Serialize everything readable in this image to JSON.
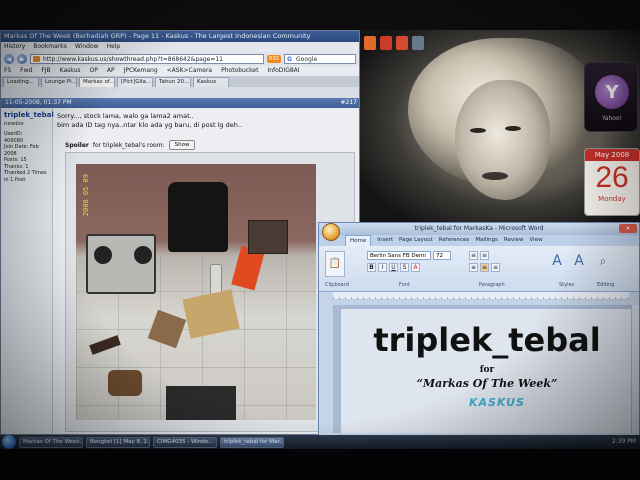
{
  "browser": {
    "title": "Markas Of The Week (Berhadiah GRP) - Page 11 - Kaskus - The Largest Indonesian Community",
    "menu": [
      "History",
      "Bookmarks",
      "Window",
      "Help"
    ],
    "url": "http://www.kaskus.us/showthread.php?t=868642&page=11",
    "rss": "RSS",
    "search_placeholder": "Google",
    "bookmarks": [
      "FS",
      "Fwd",
      "FJB",
      "Kaskus",
      "OP",
      "AP",
      "JPCKemang",
      "<ASK>Camera",
      "Photobucket",
      "InfoDIG8AI"
    ],
    "tabs": [
      "Loading...",
      "Lounge Pi...",
      "Markas of...",
      "[Pict]Gila...",
      "Tahun 20...",
      "Kaskus"
    ],
    "post_date": "11-05-2008, 01:37 PM",
    "post_number": "#217",
    "user": {
      "name": "triplek_tebal",
      "title": "newbie",
      "stats": "UserID:\n409080\nJoin Date: Feb 2008\nPosts: 15\nThanks: 1\nThanked 2 Times in 1 Post"
    },
    "post_lines": [
      "Sorry..., stock lama, walo ga lama2 amat..",
      "bim ada ID tag nya..ntar klo ada yg baru, di post lg deh.."
    ],
    "spoiler_label": "Spoiler",
    "spoiler_text": "for triplek_tebal's room:",
    "show_button": "Show",
    "photo_stamp": "2008 05 09"
  },
  "word": {
    "title": "triplek_tebal for MarkasKa - Microsoft Word",
    "ribbon_tabs": [
      "Home",
      "Insert",
      "Page Layout",
      "References",
      "Mailings",
      "Review",
      "View"
    ],
    "font_name": "Berlin Sans FB Demi",
    "font_size": "72",
    "groups": [
      "Clipboard",
      "Font",
      "Paragraph",
      "Styles",
      "Editing"
    ],
    "style_buttons": [
      "Quick Styles",
      "Change Styles",
      "Editing"
    ],
    "doc": {
      "heading": "triplek_tebal",
      "for_line": "for",
      "subtitle": "“Markas Of The Week”",
      "logo": "KASKUS"
    }
  },
  "desktop": {
    "calendar_month": "May 2008",
    "calendar_day": "26",
    "calendar_weekday": "Monday",
    "yahoo_label": "Yahoo!"
  },
  "taskbar": {
    "items": [
      "Markas Of The Week...",
      "Bengkel [1] May 8, 2...",
      "CIMG4035 - Windo...",
      "triplek_tebal for Mar..."
    ],
    "active_index": 3,
    "clock": "2:39 PM"
  }
}
